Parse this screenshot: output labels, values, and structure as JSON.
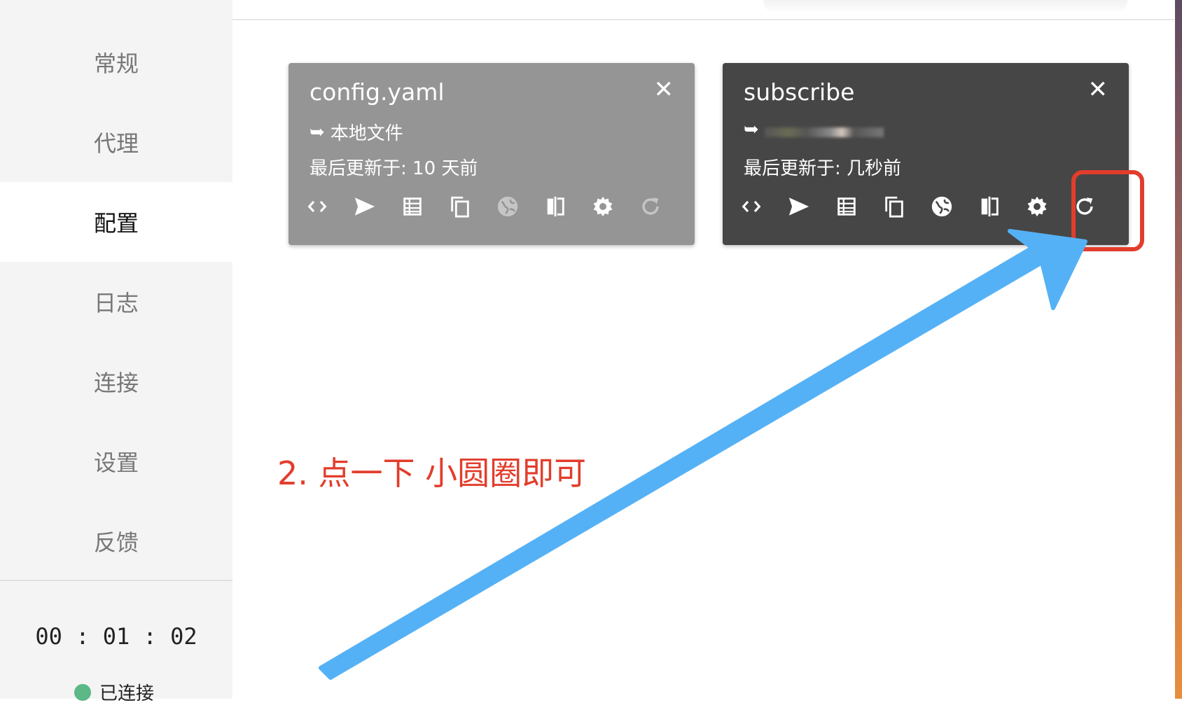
{
  "sidebar": {
    "items": [
      {
        "label": "常规",
        "active": false
      },
      {
        "label": "代理",
        "active": false
      },
      {
        "label": "配置",
        "active": true
      },
      {
        "label": "日志",
        "active": false
      },
      {
        "label": "连接",
        "active": false
      },
      {
        "label": "设置",
        "active": false
      },
      {
        "label": "反馈",
        "active": false
      }
    ],
    "timer": "00 : 01 : 02",
    "status_label": "已连接",
    "status_color": "#5cb887"
  },
  "profiles": [
    {
      "name": "config.yaml",
      "close": "✕",
      "source_arrow": "➥",
      "source": "本地文件",
      "updated": "最后更新于: 10 天前",
      "selected": false,
      "update_disabled": true
    },
    {
      "name": "subscribe",
      "close": "✕",
      "source_arrow": "➥",
      "source": "",
      "updated": "最后更新于: 几秒前",
      "selected": true,
      "update_disabled": false
    }
  ],
  "toolbar_icons": [
    "code-icon",
    "send-icon",
    "table-icon",
    "copy-icon",
    "globe-icon",
    "compare-icon",
    "gear-icon",
    "refresh-icon"
  ],
  "annotation": {
    "text": "2. 点一下 小圆圈即可",
    "color": "#e23d2c",
    "arrow_color": "#55b1f5"
  },
  "colors": {
    "card_inactive": "#959595",
    "card_active": "#464646",
    "highlight": "#e23d2c"
  }
}
